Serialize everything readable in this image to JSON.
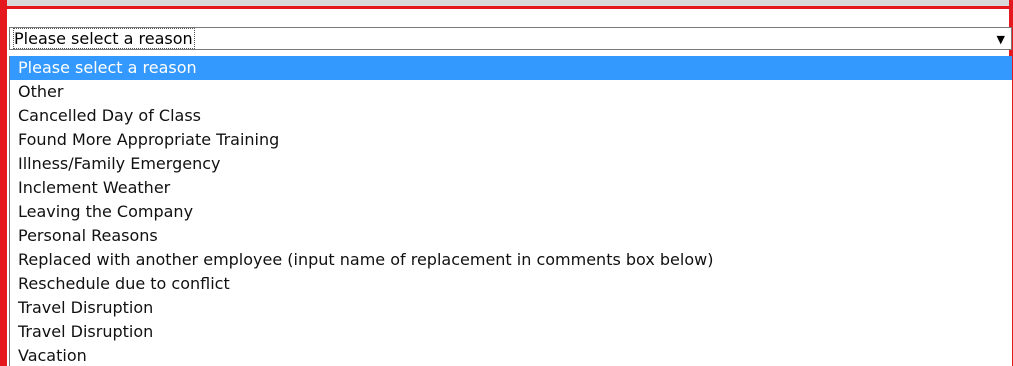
{
  "select": {
    "current_value": "Please select a reason",
    "arrow_icon": "triangle-down-icon"
  },
  "options": [
    {
      "label": "Please select a reason",
      "highlighted": true
    },
    {
      "label": "Other"
    },
    {
      "label": "Cancelled Day of Class"
    },
    {
      "label": "Found More Appropriate Training"
    },
    {
      "label": "Illness/Family Emergency"
    },
    {
      "label": "Inclement Weather"
    },
    {
      "label": "Leaving the Company"
    },
    {
      "label": "Personal Reasons"
    },
    {
      "label": "Replaced with another employee (input name of replacement in comments box below)"
    },
    {
      "label": "Reschedule due to conflict"
    },
    {
      "label": "Travel Disruption"
    },
    {
      "label": "Travel Disruption"
    },
    {
      "label": "Vacation"
    }
  ],
  "colors": {
    "accent_border": "#e4181d",
    "highlight": "#3399ff"
  }
}
